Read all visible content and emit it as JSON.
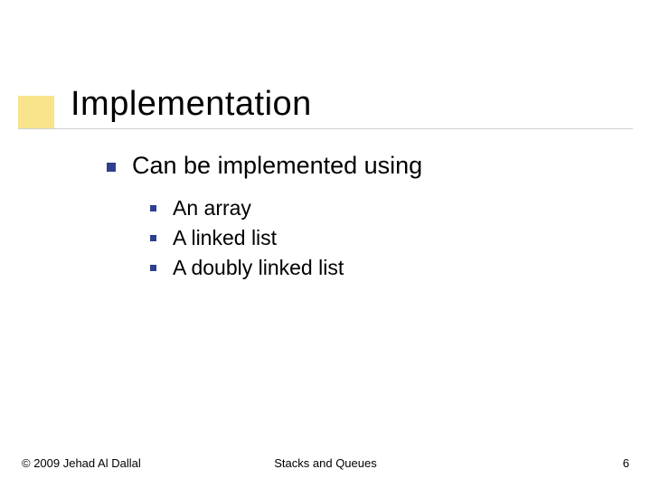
{
  "title": "Implementation",
  "body": {
    "level1": "Can be implemented using",
    "level2": [
      "An array",
      "A linked list",
      "A doubly linked list"
    ]
  },
  "footer": {
    "left": "© 2009 Jehad Al Dallal",
    "center": "Stacks and Queues",
    "right": "6"
  }
}
